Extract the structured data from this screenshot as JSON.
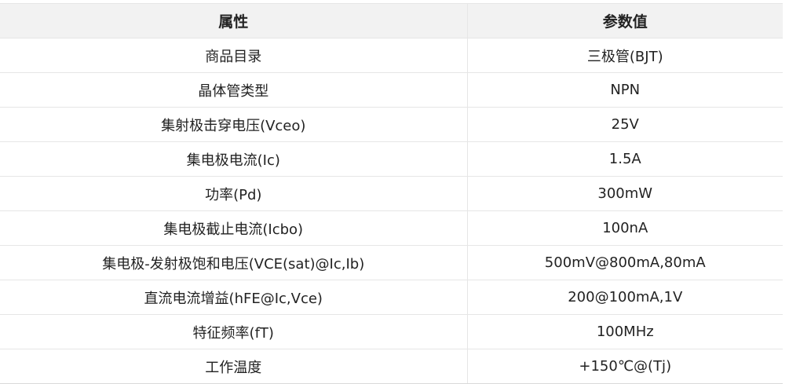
{
  "table": {
    "headers": {
      "attribute": "属性",
      "value": "参数值"
    },
    "rows": [
      {
        "attribute": "商品目录",
        "value": "三极管(BJT)"
      },
      {
        "attribute": "晶体管类型",
        "value": "NPN"
      },
      {
        "attribute": "集射极击穿电压(Vceo)",
        "value": "25V"
      },
      {
        "attribute": "集电极电流(Ic)",
        "value": "1.5A"
      },
      {
        "attribute": "功率(Pd)",
        "value": "300mW"
      },
      {
        "attribute": "集电极截止电流(Icbo)",
        "value": "100nA"
      },
      {
        "attribute": "集电极-发射极饱和电压(VCE(sat)@Ic,Ib)",
        "value": "500mV@800mA,80mA"
      },
      {
        "attribute": "直流电流增益(hFE@Ic,Vce)",
        "value": "200@100mA,1V"
      },
      {
        "attribute": "特征频率(fT)",
        "value": "100MHz"
      },
      {
        "attribute": "工作温度",
        "value": "+150℃@(Tj)"
      }
    ]
  }
}
